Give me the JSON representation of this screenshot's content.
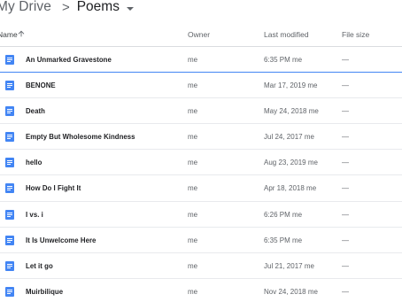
{
  "breadcrumb": {
    "root": "My Drive",
    "separator": ">",
    "current": "Poems"
  },
  "columns": {
    "name": "Name",
    "owner": "Owner",
    "last_modified": "Last modified",
    "file_size": "File size"
  },
  "icons": {
    "sort": "arrow-upward-icon",
    "file": "google-docs-icon",
    "dropdown": "caret-down-icon"
  },
  "colors": {
    "doc_icon": "#4285f4",
    "selection_line": "#4285f4"
  },
  "files": [
    {
      "name": "An Unmarked Gravestone",
      "owner": "me",
      "modified": "6:35 PM  me",
      "size": "—",
      "selected": true
    },
    {
      "name": "BENONE",
      "owner": "me",
      "modified": "Mar 17, 2019  me",
      "size": "—"
    },
    {
      "name": "Death",
      "owner": "me",
      "modified": "May 24, 2018  me",
      "size": "—"
    },
    {
      "name": "Empty But Wholesome Kindness",
      "owner": "me",
      "modified": "Jul 24, 2017  me",
      "size": "—"
    },
    {
      "name": "hello",
      "owner": "me",
      "modified": "Aug 23, 2019  me",
      "size": "—"
    },
    {
      "name": "How Do I Fight It",
      "owner": "me",
      "modified": "Apr 18, 2018  me",
      "size": "—"
    },
    {
      "name": "I vs. i",
      "owner": "me",
      "modified": "6:26 PM  me",
      "size": "—"
    },
    {
      "name": "It Is Unwelcome Here",
      "owner": "me",
      "modified": "6:35 PM  me",
      "size": "—"
    },
    {
      "name": "Let it go",
      "owner": "me",
      "modified": "Jul 21, 2017  me",
      "size": "—"
    },
    {
      "name": "Muirbilique",
      "owner": "me",
      "modified": "Nov 24, 2018  me",
      "size": "—"
    }
  ]
}
